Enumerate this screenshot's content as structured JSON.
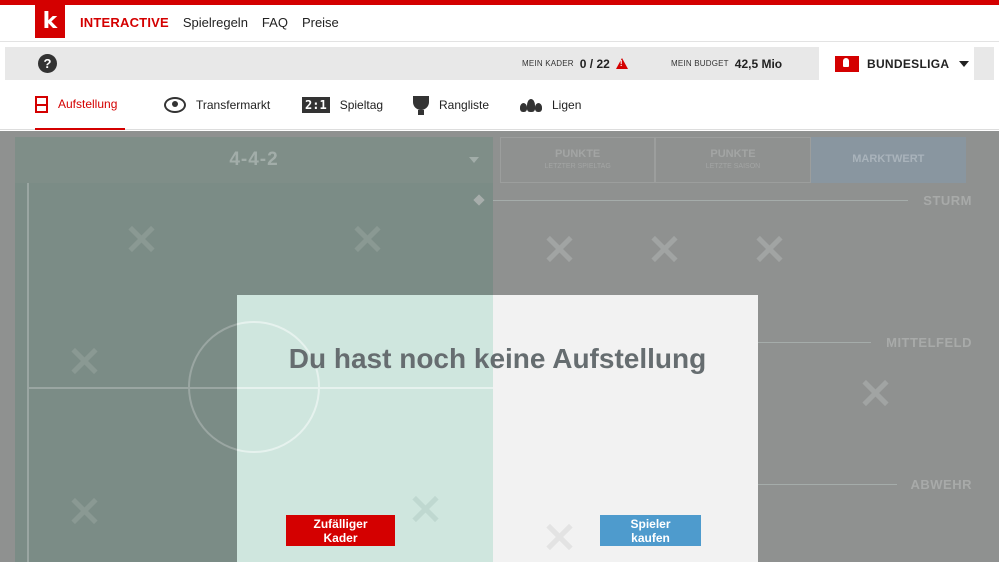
{
  "brand": {
    "logo_letter": "k",
    "section": "INTERACTIVE",
    "links": [
      "Spielregeln",
      "FAQ",
      "Preise"
    ]
  },
  "infobar": {
    "help": "?",
    "kader_label": "MEIN KADER",
    "kader_value": "0 / 22",
    "budget_label": "MEIN BUDGET",
    "budget_value": "42,5 Mio",
    "league": "BUNDESLIGA"
  },
  "subnav": [
    {
      "label": "Aufstellung",
      "icon": "lineup-icon",
      "active": true
    },
    {
      "label": "Transfermarkt",
      "icon": "transfer-icon"
    },
    {
      "label": "Spieltag",
      "icon": "score-icon",
      "badge": "2:1"
    },
    {
      "label": "Rangliste",
      "icon": "trophy-icon"
    },
    {
      "label": "Ligen",
      "icon": "people-icon"
    }
  ],
  "pitch": {
    "formation": "4-4-2"
  },
  "sort_tabs": [
    {
      "label": "PUNKTE",
      "sub": "LETZTER SPIELTAG"
    },
    {
      "label": "PUNKTE",
      "sub": "LETZTE SAISON"
    },
    {
      "label": "MARKTWERT",
      "selected": true
    }
  ],
  "rows": [
    "STURM",
    "MITTELFELD",
    "ABWEHR"
  ],
  "modal": {
    "title": "Du hast noch keine Aufstellung",
    "random_button": "Zufälliger Kader",
    "buy_button": "Spieler kaufen"
  },
  "colors": {
    "brand_red": "#d40000",
    "button_blue": "#4e9bcd",
    "pitch_green": "#cfe6de"
  }
}
